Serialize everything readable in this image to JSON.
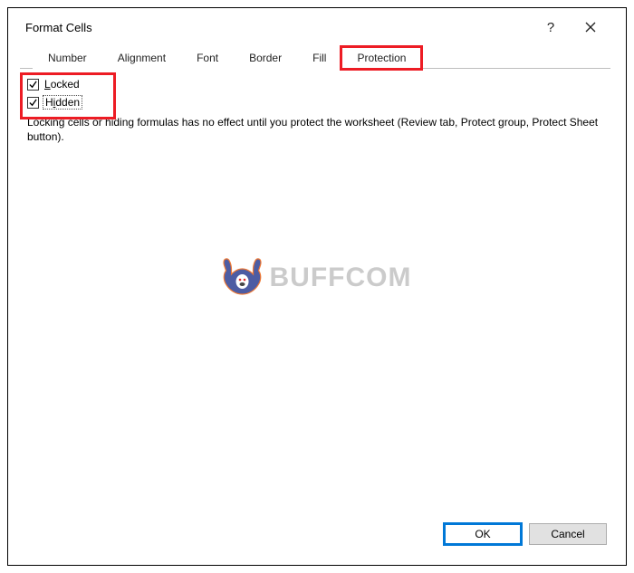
{
  "dialog": {
    "title": "Format Cells",
    "help_symbol": "?",
    "tabs": [
      {
        "label": "Number"
      },
      {
        "label": "Alignment"
      },
      {
        "label": "Font"
      },
      {
        "label": "Border"
      },
      {
        "label": "Fill"
      },
      {
        "label": "Protection"
      }
    ],
    "protection": {
      "locked_prefix": "L",
      "locked_rest": "ocked",
      "hidden_prefix": "H",
      "hidden_underline": "i",
      "hidden_rest": "dden",
      "info": "Locking cells or hiding formulas has no effect until you protect the worksheet (Review tab, Protect group, Protect Sheet button)."
    }
  },
  "buttons": {
    "ok": "OK",
    "cancel": "Cancel"
  },
  "watermark": {
    "text": "BUFFCOM"
  }
}
